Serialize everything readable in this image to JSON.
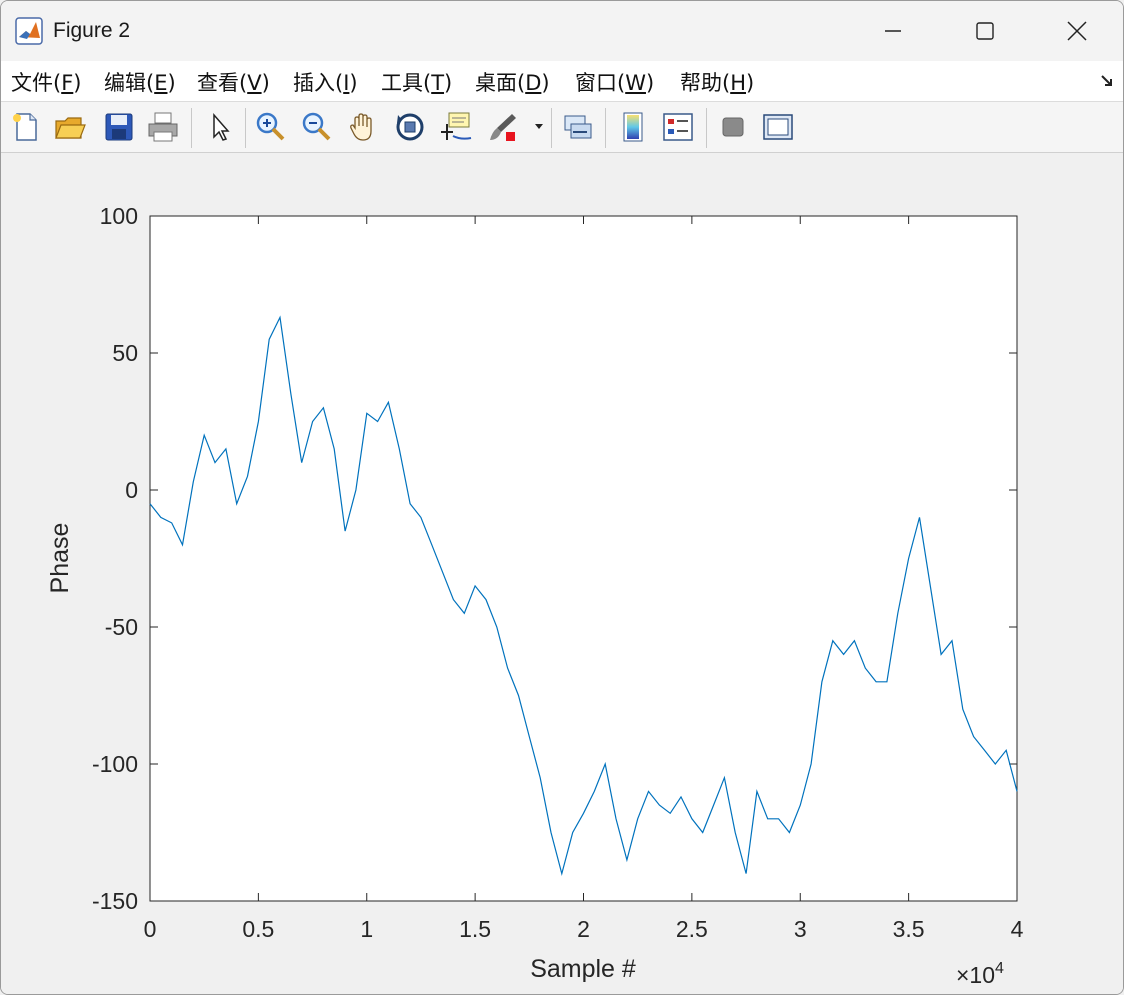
{
  "window": {
    "title": "Figure 2",
    "controls": {
      "minimize": "minimize",
      "maximize": "maximize",
      "close": "close"
    }
  },
  "menu": [
    {
      "text": "文件(",
      "key": "F",
      "end": ")"
    },
    {
      "text": "编辑(",
      "key": "E",
      "end": ")"
    },
    {
      "text": "查看(",
      "key": "V",
      "end": ")"
    },
    {
      "text": "插入(",
      "key": "I",
      "end": ")"
    },
    {
      "text": "工具(",
      "key": "T",
      "end": ")"
    },
    {
      "text": "桌面(",
      "key": "D",
      "end": ")"
    },
    {
      "text": "窗口(",
      "key": "W",
      "end": ")"
    },
    {
      "text": "帮助(",
      "key": "H",
      "end": ")"
    }
  ],
  "toolbar": [
    {
      "name": "new-figure-icon"
    },
    {
      "name": "open-file-icon"
    },
    {
      "name": "save-icon"
    },
    {
      "name": "print-icon"
    },
    {
      "name": "edit-plot-arrow-icon"
    },
    {
      "name": "zoom-in-icon"
    },
    {
      "name": "zoom-out-icon"
    },
    {
      "name": "pan-hand-icon"
    },
    {
      "name": "rotate-3d-icon"
    },
    {
      "name": "data-cursor-icon"
    },
    {
      "name": "brush-icon"
    },
    {
      "name": "link-plot-icon"
    },
    {
      "name": "colorbar-icon"
    },
    {
      "name": "legend-icon"
    },
    {
      "name": "hide-plot-tools-icon"
    },
    {
      "name": "show-plot-tools-icon"
    }
  ],
  "chart_data": {
    "type": "line",
    "xlabel": "Sample #",
    "ylabel": "Phase",
    "x_exponent_label": "×10",
    "x_exponent_power": "4",
    "xlim": [
      0,
      40000
    ],
    "ylim": [
      -150,
      100
    ],
    "xticks": [
      0,
      5000,
      10000,
      15000,
      20000,
      25000,
      30000,
      35000,
      40000
    ],
    "xtick_labels": [
      "0",
      "0.5",
      "1",
      "1.5",
      "2",
      "2.5",
      "3",
      "3.5",
      "4"
    ],
    "yticks": [
      100,
      50,
      0,
      -50,
      -100,
      -150
    ],
    "ytick_labels": [
      "100",
      "50",
      "0",
      "-50",
      "-100",
      "-150"
    ],
    "line_color": "#0072bd",
    "series": [
      {
        "x": [
          0,
          500,
          1000,
          1500,
          2000,
          2500,
          3000,
          3500,
          4000,
          4500,
          5000,
          5500,
          6000,
          6500,
          7000,
          7500,
          8000,
          8500,
          9000,
          9500,
          10000,
          10500,
          11000,
          11500,
          12000,
          12500,
          13000,
          13500,
          14000,
          14500,
          15000,
          15500,
          16000,
          16500,
          17000,
          17500,
          18000,
          18500,
          19000,
          19500,
          20000,
          20500,
          21000,
          21500,
          22000,
          22500,
          23000,
          23500,
          24000,
          24500,
          25000,
          25500,
          26000,
          26500,
          27000,
          27500,
          28000,
          28500,
          29000,
          29500,
          30000,
          30500,
          31000,
          31500,
          32000,
          32500,
          33000,
          33500,
          34000,
          34500,
          35000,
          35500,
          36000,
          36500,
          37000,
          37500,
          38000,
          38500,
          39000,
          39500,
          40000
        ],
        "y": [
          -5,
          -10,
          -12,
          -20,
          3,
          20,
          10,
          15,
          -5,
          5,
          25,
          55,
          63,
          35,
          10,
          25,
          30,
          15,
          -15,
          0,
          28,
          25,
          32,
          15,
          -5,
          -10,
          -20,
          -30,
          -40,
          -45,
          -35,
          -40,
          -50,
          -65,
          -75,
          -90,
          -105,
          -125,
          -140,
          -125,
          -118,
          -110,
          -100,
          -120,
          -135,
          -120,
          -110,
          -115,
          -118,
          -112,
          -120,
          -125,
          -115,
          -105,
          -125,
          -140,
          -110,
          -120,
          -120,
          -125,
          -115,
          -100,
          -70,
          -55,
          -60,
          -55,
          -65,
          -70,
          -70,
          -45,
          -25,
          -10,
          -35,
          -60,
          -55,
          -80,
          -90,
          -95,
          -100,
          -95,
          -110
        ]
      }
    ]
  }
}
